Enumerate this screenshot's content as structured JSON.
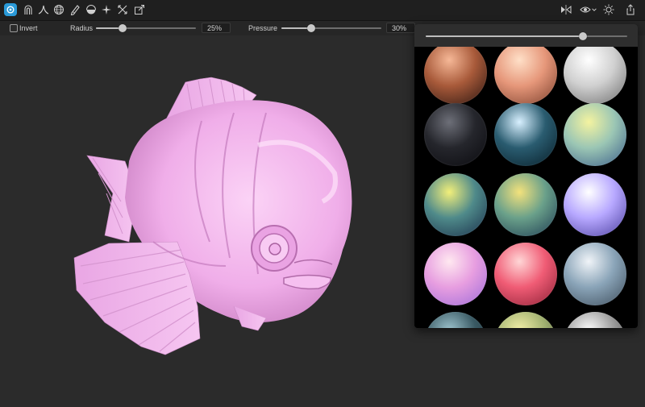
{
  "toolbar": {
    "tools": [
      {
        "name": "brush-tool",
        "icon": "brush-icon",
        "active": true
      },
      {
        "name": "clay-tool",
        "icon": "arch-icon"
      },
      {
        "name": "crease-tool",
        "icon": "crease-icon"
      },
      {
        "name": "inflate-tool",
        "icon": "sphere-icon"
      },
      {
        "name": "paint-tool",
        "icon": "pencil-icon"
      },
      {
        "name": "flatten-tool",
        "icon": "hemisphere-icon"
      },
      {
        "name": "pinch-tool",
        "icon": "sparkle-icon"
      },
      {
        "name": "move-tool",
        "icon": "arrows-icon"
      },
      {
        "name": "transform-tool",
        "icon": "transform-icon"
      }
    ],
    "right_icons": [
      "symmetry-icon",
      "eye-icon",
      "chevron-down-icon",
      "sun-icon",
      "share-icon"
    ]
  },
  "options": {
    "invert_label": "Invert",
    "invert_checked": false,
    "radius_label": "Radius",
    "radius_value": "25%",
    "radius_level": 0.27,
    "pressure_label": "Pressure",
    "pressure_value": "30%",
    "pressure_level": 0.3
  },
  "matcap_panel": {
    "slider_level": 0.78,
    "materials": [
      {
        "name": "bronze",
        "colors": [
          "#f6b897",
          "#a85a3a",
          "#2a1510"
        ]
      },
      {
        "name": "skin",
        "colors": [
          "#ffe0c8",
          "#e6977a",
          "#7a3f2c"
        ]
      },
      {
        "name": "white-clay",
        "colors": [
          "#ffffff",
          "#d0d0d0",
          "#6c6c6c"
        ]
      },
      {
        "name": "dark-rim",
        "colors": [
          "#6d6f78",
          "#25262c",
          "#0a0a0e"
        ]
      },
      {
        "name": "blue-sparkle",
        "colors": [
          "#d8f0ff",
          "#2a5c70",
          "#071c26"
        ]
      },
      {
        "name": "green-blue",
        "colors": [
          "#f4f3a0",
          "#9bc6b4",
          "#3a5d8a"
        ]
      },
      {
        "name": "yellow-teal",
        "colors": [
          "#f2ef7a",
          "#4f8a8a",
          "#1a2e4a"
        ]
      },
      {
        "name": "yellow-banded",
        "colors": [
          "#f3e27c",
          "#6aa08a",
          "#1d3a52"
        ]
      },
      {
        "name": "lavender",
        "colors": [
          "#ffffff",
          "#b7a8ff",
          "#4a3e9e"
        ]
      },
      {
        "name": "pink-pearl",
        "colors": [
          "#ffe8f0",
          "#e79ee0",
          "#9d6bd9"
        ]
      },
      {
        "name": "red-pink",
        "colors": [
          "#ffd6d6",
          "#f05c75",
          "#8a1f34"
        ]
      },
      {
        "name": "silver-blue",
        "colors": [
          "#f0f4f8",
          "#8aa4b8",
          "#3d4c5a"
        ]
      },
      {
        "name": "teal-bottom",
        "colors": [
          "#9fc5cf",
          "#3a5a64",
          "#132228"
        ]
      },
      {
        "name": "yellow-bottom",
        "colors": [
          "#f4f0a8",
          "#a0b070",
          "#3a4030"
        ]
      },
      {
        "name": "chrome-bottom",
        "colors": [
          "#ffffff",
          "#9a9a9a",
          "#2a2a2a"
        ]
      }
    ]
  },
  "colors": {
    "accent": "#2a9ad8",
    "model": "#f2b8ec"
  }
}
